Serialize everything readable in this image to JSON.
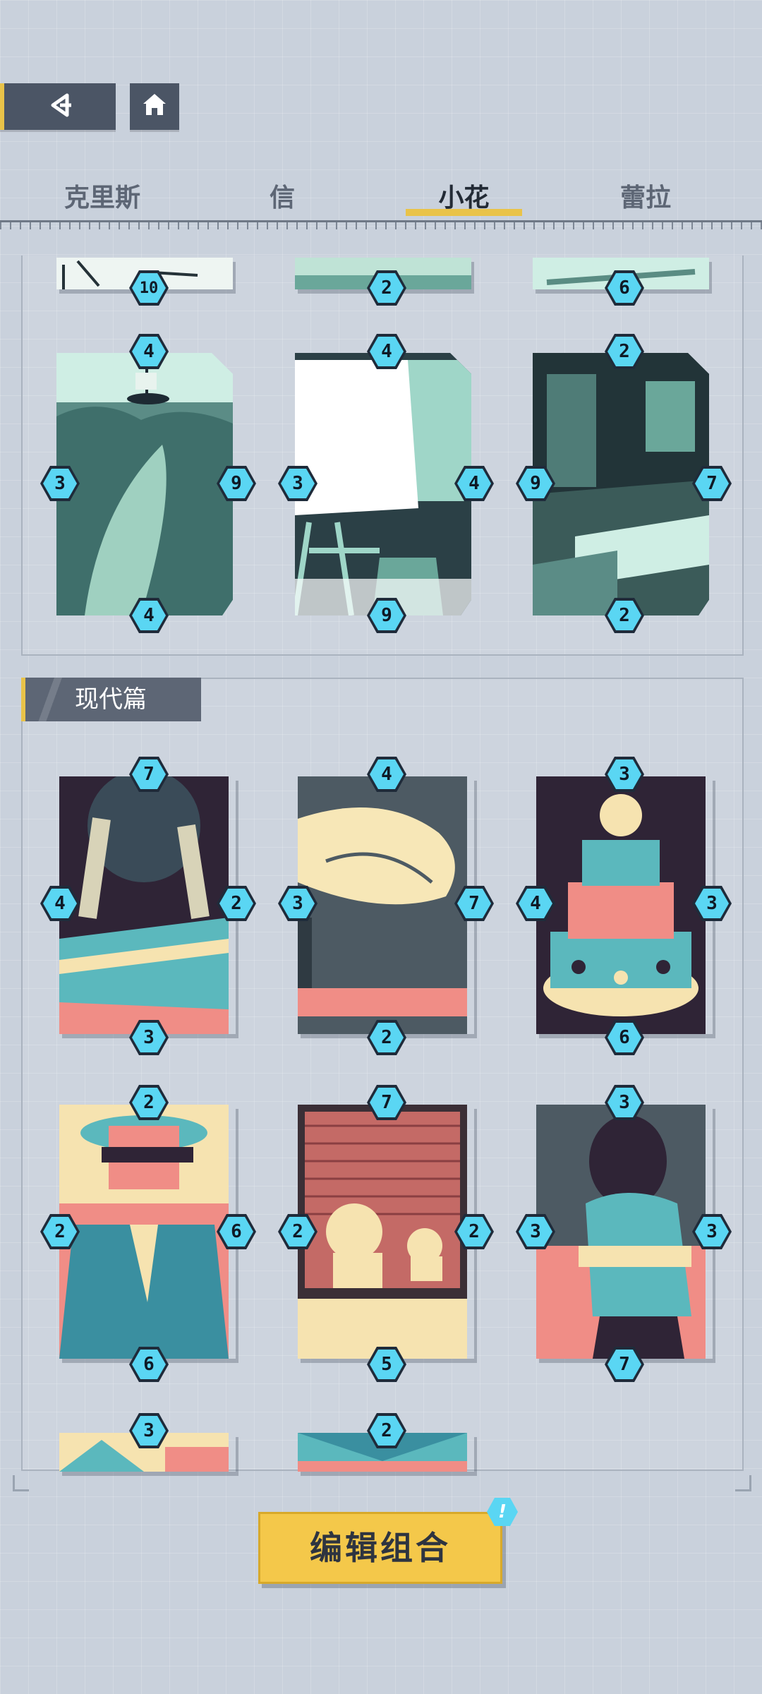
{
  "tabs": [
    "克里斯",
    "信",
    "小花",
    "蕾拉"
  ],
  "active_tab": "小花",
  "section_title": "现代篇",
  "edit_button": "编辑组合",
  "edit_badge": "!",
  "icons": {
    "back": "back-arrow-icon",
    "home": "home-icon"
  },
  "colors": {
    "accent": "#e9c349",
    "badge": "#5ad6f3",
    "panel": "#4b5565"
  },
  "partial_top_row": [
    {
      "bottom": "10"
    },
    {
      "bottom": "2"
    },
    {
      "bottom": "6"
    }
  ],
  "top_cards": [
    {
      "name": "whale-ship-card",
      "top": "4",
      "left": "3",
      "right": "9",
      "bottom": "4"
    },
    {
      "name": "easel-card",
      "top": "4",
      "left": "3",
      "right": "4",
      "bottom": "9"
    },
    {
      "name": "classroom-card",
      "top": "2",
      "left": "9",
      "right": "7",
      "bottom": "2"
    }
  ],
  "modern_cards": [
    {
      "name": "two-people-running-card",
      "top": "7",
      "left": "4",
      "right": "2",
      "bottom": "3"
    },
    {
      "name": "hands-card",
      "top": "4",
      "left": "3",
      "right": "7",
      "bottom": "2"
    },
    {
      "name": "cake-card",
      "top": "3",
      "left": "4",
      "right": "3",
      "bottom": "6"
    },
    {
      "name": "masked-man-card",
      "top": "2",
      "left": "2",
      "right": "6",
      "bottom": "6"
    },
    {
      "name": "flowers-window-card",
      "top": "7",
      "left": "2",
      "right": "2",
      "bottom": "5"
    },
    {
      "name": "girl-at-window-card",
      "top": "3",
      "left": "3",
      "right": "3",
      "bottom": "7"
    }
  ],
  "partial_bottom_row": [
    {
      "top": "3"
    },
    {
      "top": "2"
    }
  ]
}
